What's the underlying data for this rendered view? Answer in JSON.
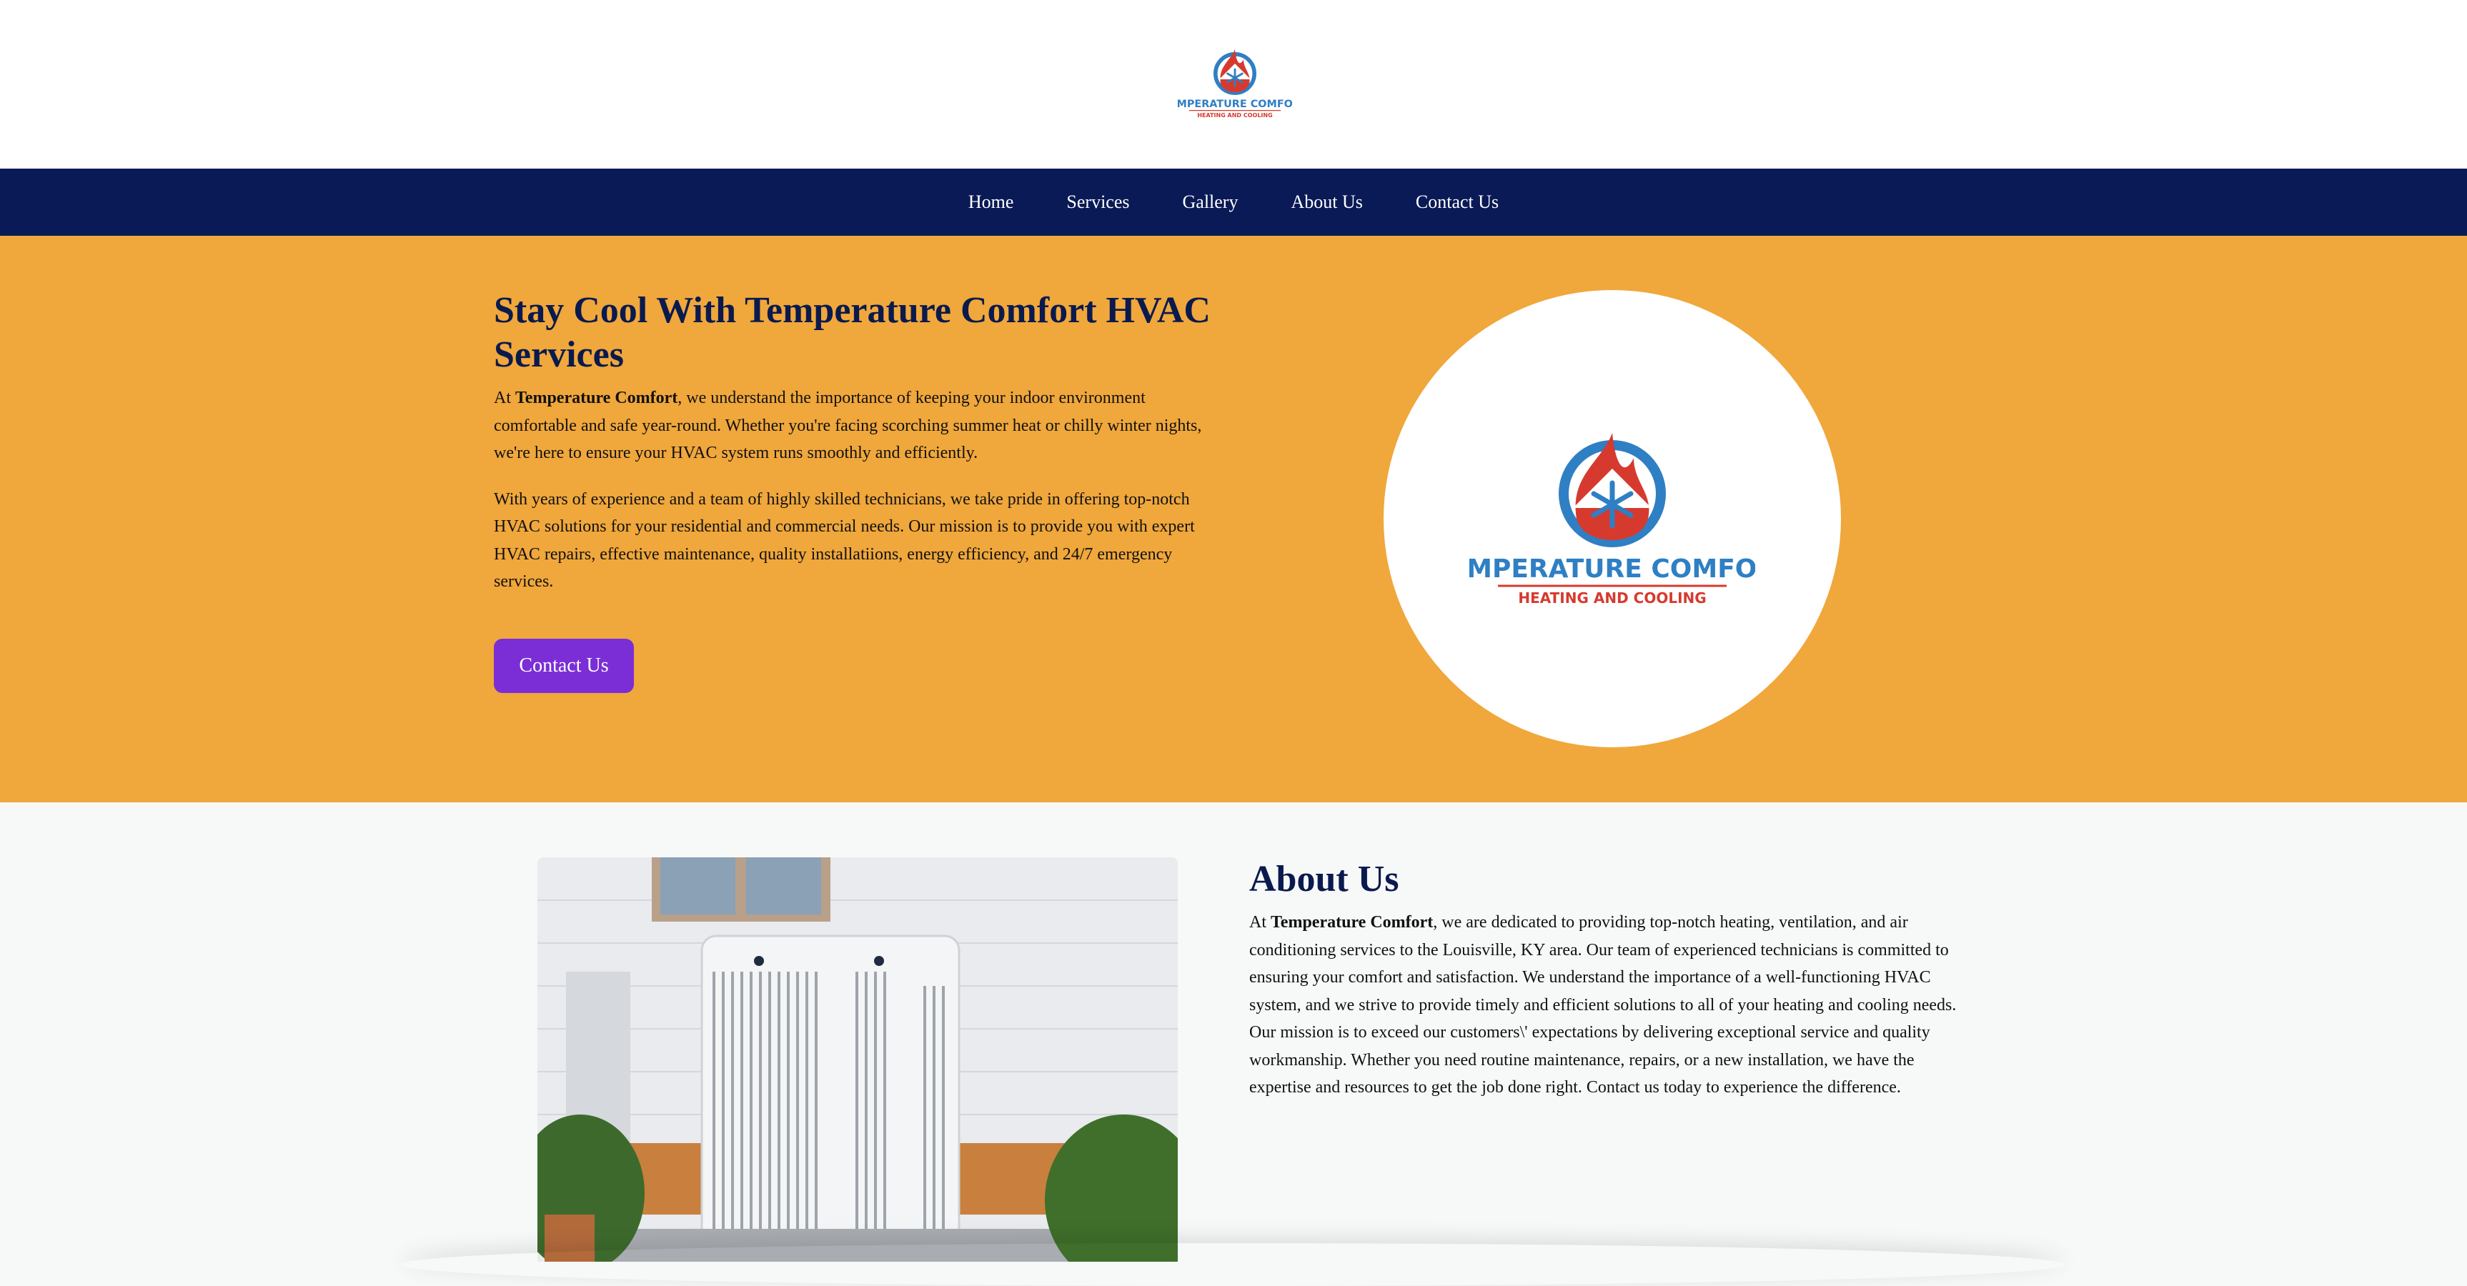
{
  "brand": {
    "logo_text_top": "TEMPERATURE COMFORT",
    "logo_text_bottom": "HEATING AND COOLING",
    "colors": {
      "red": "#d63a2f",
      "blue": "#2f7fc4",
      "navy": "#0a1a56",
      "orange": "#f0a73b",
      "purple": "#7b2ed6"
    }
  },
  "nav": {
    "items": [
      {
        "label": "Home"
      },
      {
        "label": "Services"
      },
      {
        "label": "Gallery"
      },
      {
        "label": "About Us"
      },
      {
        "label": "Contact Us"
      }
    ]
  },
  "hero": {
    "title": "Stay Cool With Temperature Comfort HVAC Services",
    "p1_prefix": "At ",
    "p1_bold": "Temperature Comfort",
    "p1_rest": ", we understand the importance of keeping your indoor environment comfortable and safe year-round. Whether you're facing scorching summer heat or chilly winter nights, we're here to ensure your HVAC system runs smoothly and efficiently.",
    "p2": "With years of experience and a team of highly skilled technicians, we take pride in offering top-notch HVAC solutions for your residential and commercial needs. Our mission is to provide you with expert HVAC repairs, effective maintenance, quality installatiions, energy efficiency, and 24/7 emergency services.",
    "button_label": "Contact Us"
  },
  "about": {
    "title": "About Us",
    "p_prefix": "At ",
    "p_bold": "Temperature Comfort",
    "p_rest": ", we are dedicated to providing top-notch heating, ventilation, and air conditioning services to the Louisville, KY area. Our team of experienced technicians is committed to ensuring your comfort and satisfaction. We understand the importance of a well-functioning HVAC system, and we strive to provide timely and efficient solutions to all of your heating and cooling needs. Our mission is to exceed our customers\\' expectations by delivering exceptional service and quality workmanship. Whether you need routine maintenance, repairs, or a new installation, we have the expertise and resources to get the job done right. Contact us today to experience the difference."
  }
}
